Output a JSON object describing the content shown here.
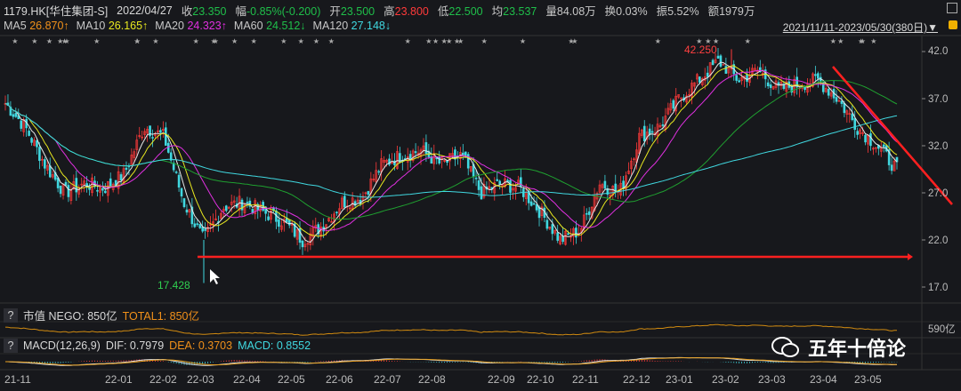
{
  "header": {
    "symbol": "1179.HK[华住集团-S]",
    "date": "2022/04/27",
    "close_label": "收",
    "close": "23.350",
    "chg_label": "幅",
    "chg": "-0.85%(-0.200)",
    "open_label": "开",
    "open": "23.500",
    "high_label": "高",
    "high": "23.800",
    "low_label": "低",
    "low": "22.500",
    "avg_label": "均",
    "avg": "23.537",
    "vol": "量84.08万",
    "turnover": "换0.03%",
    "amp": "振5.52%",
    "amount": "额1979万"
  },
  "ma": {
    "ma5_label": "MA5",
    "ma5": "26.870↑",
    "ma10_label": "MA10",
    "ma10": "26.165↑",
    "ma20_label": "MA20",
    "ma20": "24.323↑",
    "ma60_label": "MA60",
    "ma60": "24.512↓",
    "ma120_label": "MA120",
    "ma120": "27.148↓"
  },
  "range": "2021/11/11-2023/05/30(380日)▼",
  "price_axis": [
    "42.0",
    "37.0",
    "32.0",
    "27.0",
    "22.0",
    "17.0"
  ],
  "annotations": {
    "high": "42.250",
    "low": "17.428"
  },
  "nego": {
    "q": "?",
    "label": "市值 NEGO: 850亿",
    "total": "TOTAL1: 850亿",
    "axis": "590亿"
  },
  "macd": {
    "q": "?",
    "label": "MACD(12,26,9)",
    "dif": "DIF: 0.7979",
    "dea": "DEA: 0.3703",
    "macd": "MACD: 0.8552"
  },
  "dates": [
    "21-11",
    "22-01",
    "22-02",
    "22-03",
    "22-04",
    "22-05",
    "22-06",
    "22-07",
    "22-08",
    "22-09",
    "22-10",
    "22-11",
    "22-12",
    "23-01",
    "23-02",
    "23-03",
    "23-04",
    "23-05"
  ],
  "watermark": "五年十倍论",
  "colors": {
    "up": "#ff3a3a",
    "down": "#40d8e0",
    "ma5": "#e8e8e8",
    "ma10": "#e8e820",
    "ma20": "#e030e0",
    "ma60": "#1fa030",
    "ma120": "#40d8e0",
    "trend": "#ff2020"
  },
  "chart_data": {
    "type": "candlestick",
    "ylim": [
      15.5,
      43.5
    ],
    "key_closes": [
      36.5,
      34,
      30,
      27,
      28,
      27.5,
      29,
      34,
      33,
      26,
      22,
      25.5,
      26,
      25,
      24,
      22,
      23.5,
      26,
      26.5,
      30,
      31,
      31.5,
      30,
      31,
      27,
      28,
      27.5,
      25,
      22,
      23,
      28,
      27,
      33,
      34,
      37,
      39,
      41,
      39,
      40,
      38,
      38.5,
      39,
      37,
      34,
      32,
      29.5
    ],
    "high": 42.25,
    "low": 17.428
  }
}
